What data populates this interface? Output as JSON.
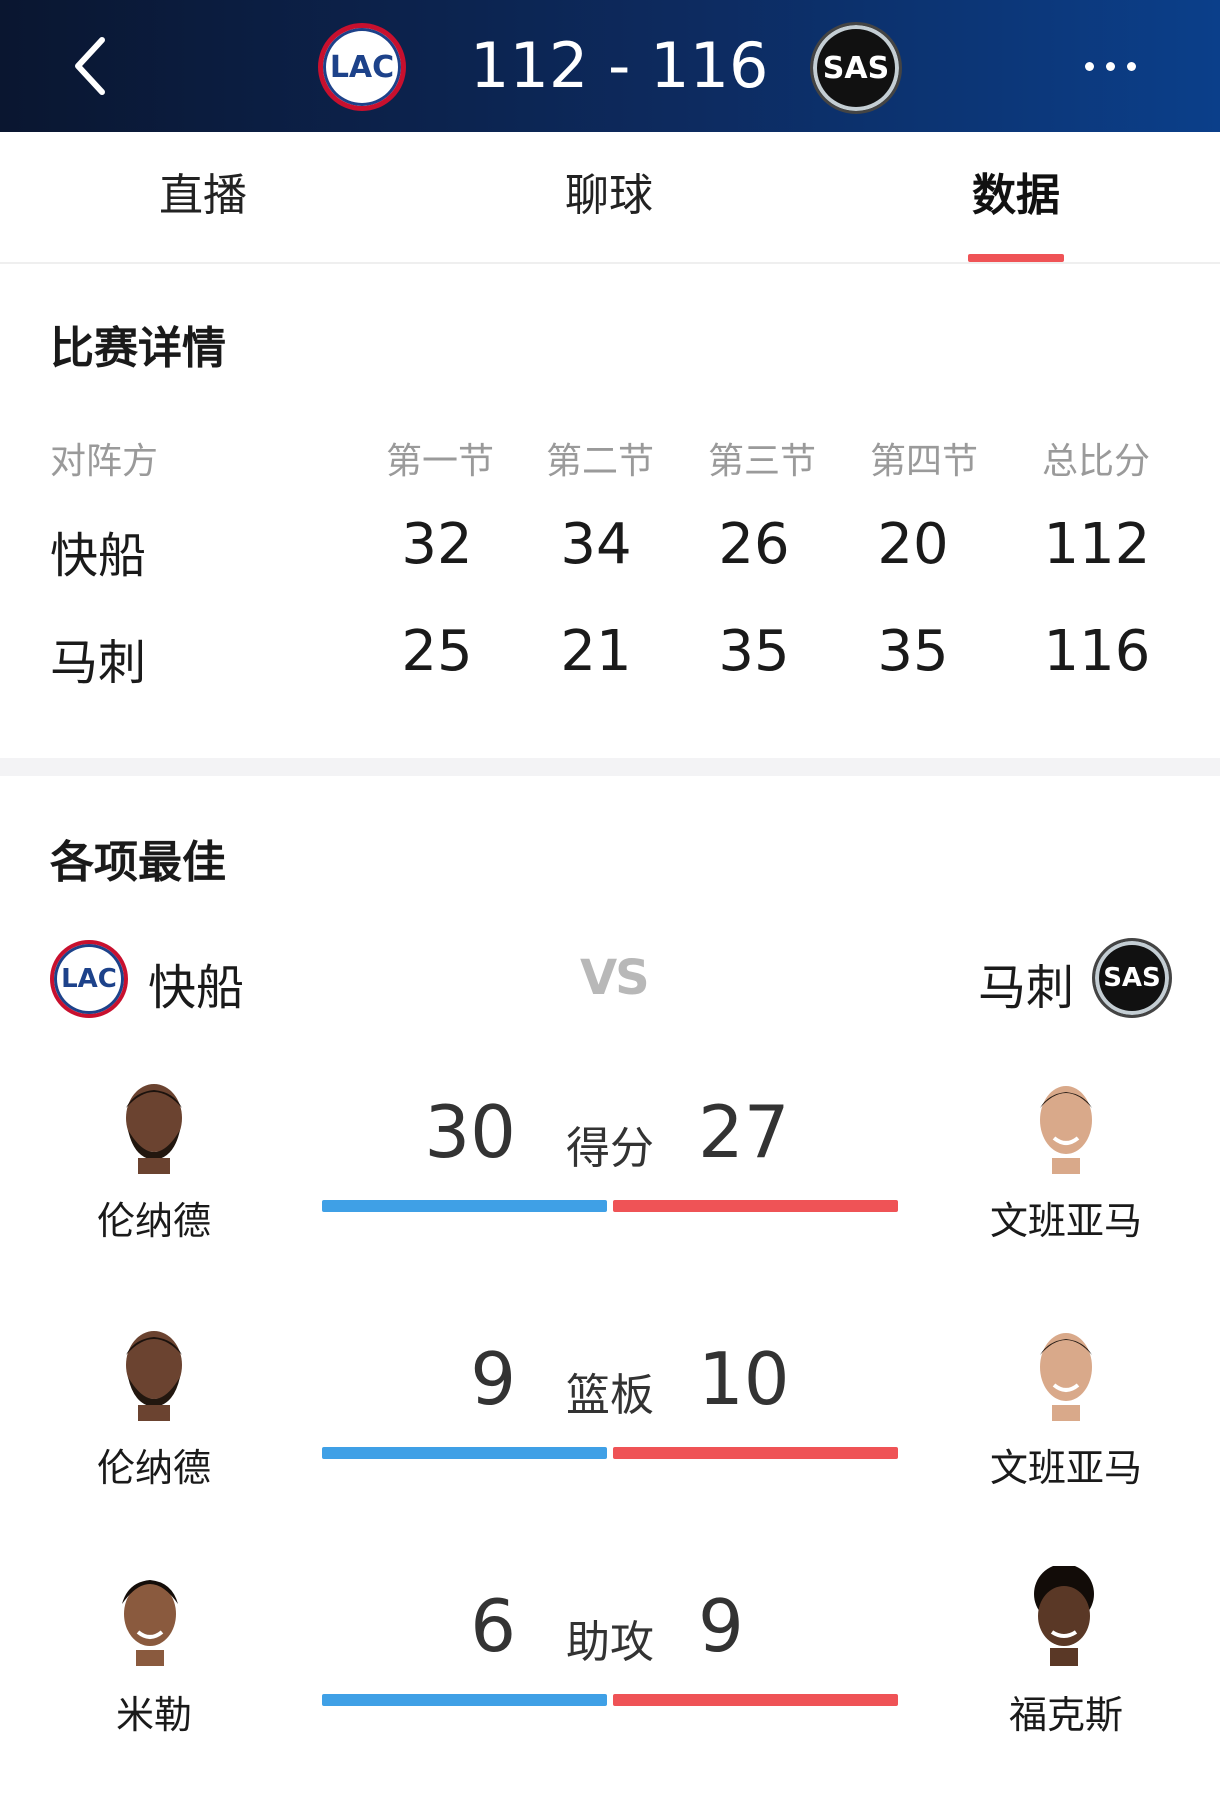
{
  "header": {
    "home_abbr": "LAC",
    "away_abbr": "SAS",
    "score_text": "112 - 116"
  },
  "tabs": [
    "直播",
    "聊球",
    "数据"
  ],
  "active_tab": 2,
  "match_detail": {
    "title": "比赛详情",
    "columns": [
      "对阵方",
      "第一节",
      "第二节",
      "第三节",
      "第四节",
      "总比分"
    ],
    "rows": [
      {
        "team": "快船",
        "scores": [
          "32",
          "34",
          "26",
          "20",
          "112"
        ]
      },
      {
        "team": "马刺",
        "scores": [
          "25",
          "21",
          "35",
          "35",
          "116"
        ]
      }
    ]
  },
  "leaders": {
    "title": "各项最佳",
    "home_team": "快船",
    "away_team": "马刺",
    "vs": "VS",
    "stats": [
      {
        "label": "得分",
        "home_value": "30",
        "away_value": "27",
        "home_player": "伦纳德",
        "away_player": "文班亚马"
      },
      {
        "label": "篮板",
        "home_value": "9",
        "away_value": "10",
        "home_player": "伦纳德",
        "away_player": "文班亚马"
      },
      {
        "label": "助攻",
        "home_value": "6",
        "away_value": "9",
        "home_player": "米勒",
        "away_player": "福克斯"
      }
    ]
  },
  "colors": {
    "header_dark": "#0a1630",
    "header_blue": "#0b3f8a",
    "accent_red": "#ef5356",
    "bar_blue": "#3fa0e6",
    "muted_text": "#9a9a9a"
  },
  "icons": {
    "back": "chevron-left-icon",
    "more": "more-horizontal-icon"
  }
}
